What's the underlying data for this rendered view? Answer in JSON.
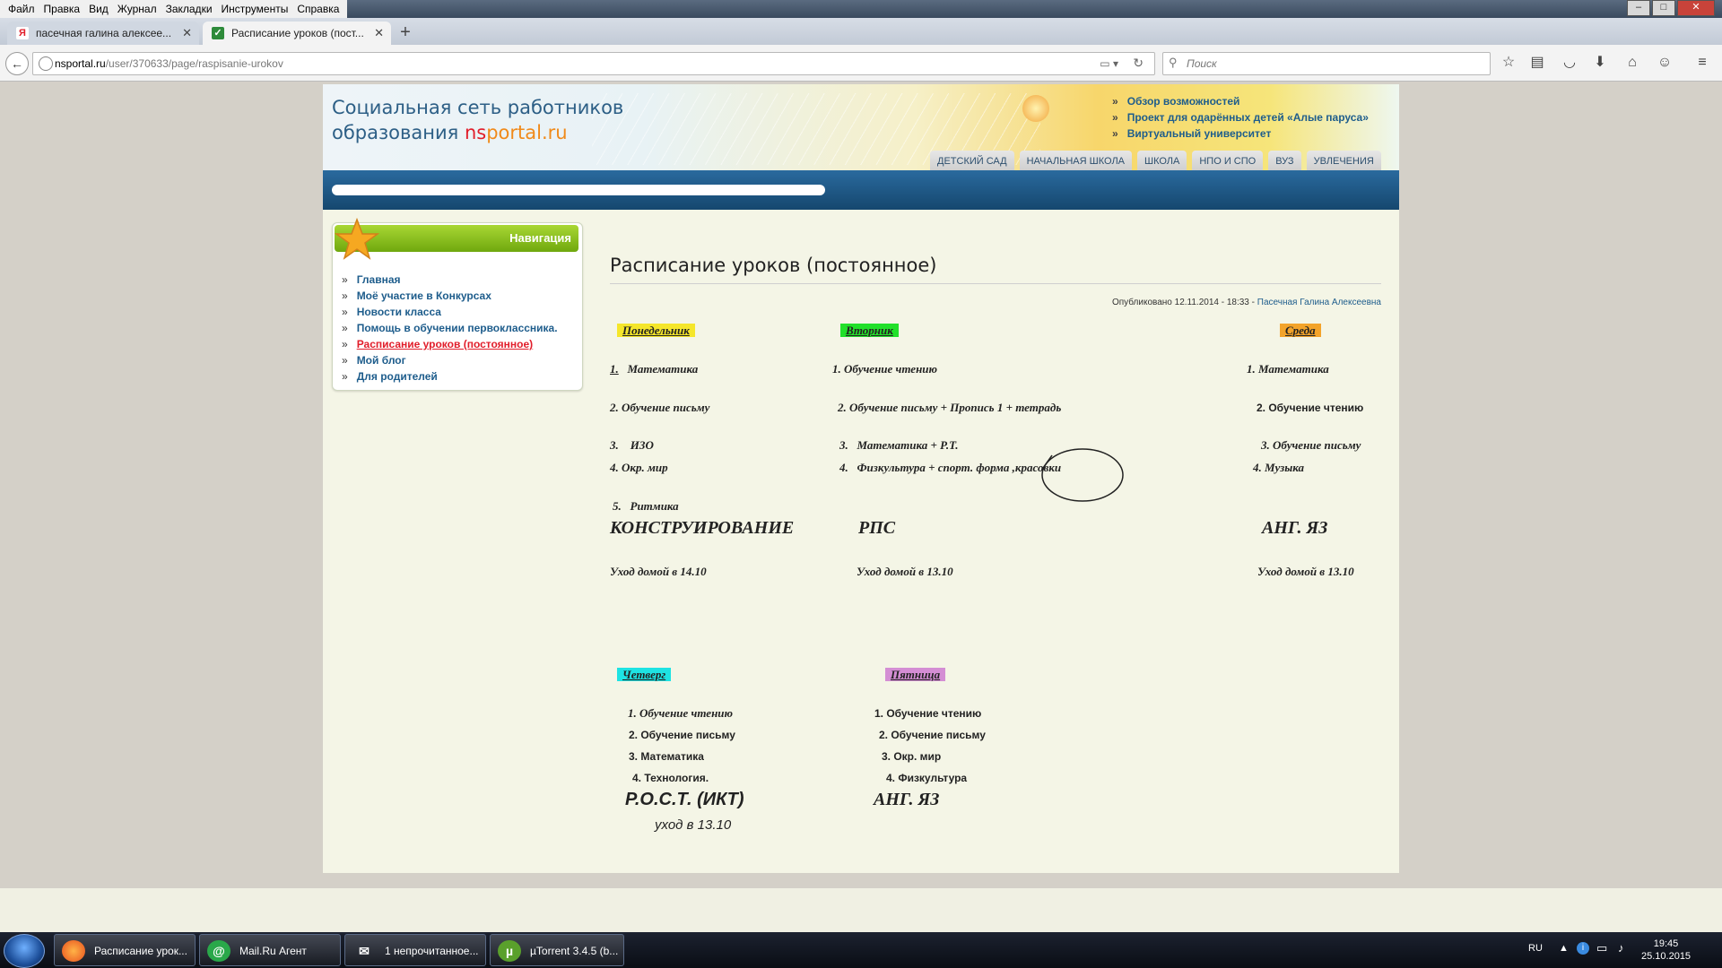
{
  "browser": {
    "menu": [
      "Файл",
      "Правка",
      "Вид",
      "Журнал",
      "Закладки",
      "Инструменты",
      "Справка"
    ],
    "tabs": [
      {
        "label": "пасечная галина алексее...",
        "favicon": "Я",
        "active": false
      },
      {
        "label": "Расписание уроков (пост...",
        "favicon": "✓",
        "active": true
      }
    ],
    "url_host": "nsportal.ru",
    "url_path": "/user/370633/page/raspisanie-urokov",
    "search_placeholder": "Поиск"
  },
  "site": {
    "title_line1": "Социальная сеть работников",
    "title_line2": "образования ",
    "brand_ns": "ns",
    "brand_portal": "portal.ru",
    "top_links": [
      "Обзор возможностей",
      "Проект для одарённых детей «Алые паруса»",
      "Виртуальный университет"
    ],
    "categories": [
      "ДЕТСКИЙ САД",
      "НАЧАЛЬНАЯ ШКОЛА",
      "ШКОЛА",
      "НПО И СПО",
      "ВУЗ",
      "УВЛЕЧЕНИЯ"
    ]
  },
  "nav": {
    "heading": "Навигация",
    "items": [
      "Главная",
      "Моё участие в Конкурсах",
      "Новости класса",
      "Помощь в обучении первоклассника.",
      "Расписание уроков (постоянное)",
      "Мой блог",
      "Для родителей"
    ],
    "active_index": 4
  },
  "article": {
    "title": "Расписание уроков (постоянное)",
    "published": "Опубликовано 12.11.2014 - 18:33 - ",
    "author": "Пасечная Галина Алексеевна"
  },
  "schedule": {
    "mon": {
      "day": "Понедельник",
      "l1n": "1.",
      "l1": "Математика",
      "l2": "2. Обучение письму",
      "l3n": "3.",
      "l3": "ИЗО",
      "l4": "4. Окр. мир",
      "l5n": "5.",
      "l5": "Ритмика",
      "extra": "КОНСТРУИРОВАНИЕ",
      "leave": "Уход домой в 14.10"
    },
    "tue": {
      "day": "Вторник",
      "l1": "1. Обучение чтению",
      "l2": "2. Обучение письму   + Пропись 1 + тетрадь",
      "l3n": "3.",
      "l3": "Математика   + Р.Т.",
      "l4n": "4.",
      "l4": "Физкультура + спорт. форма ,красовки",
      "extra": "РПС",
      "leave": "Уход домой в   13.10"
    },
    "wed": {
      "day": "Среда",
      "l1": "1. Математика",
      "l2": "2. Обучение чтению",
      "l3": "3. Обучение письму",
      "l4": "4. Музыка",
      "extra": "АНГ. ЯЗ",
      "leave": "Уход домой в 13.10"
    },
    "thu": {
      "day": "Четверг",
      "l1": "1. Обучение чтению",
      "l2": "2. Обучение письму",
      "l3": "3. Математика",
      "l4": "4. Технология.",
      "extra": "Р.О.С.Т.    (ИКТ)",
      "leave": "уход в 13.10"
    },
    "fri": {
      "day": "Пятница",
      "l1": "1. Обучение чтению",
      "l2": "2. Обучение письму",
      "l3": "3. Окр. мир",
      "l4": "4. Физкультура",
      "extra": "АНГ. ЯЗ"
    }
  },
  "taskbar": {
    "tasks": [
      {
        "label": "Расписание урок...",
        "icon": "firefox-icon"
      },
      {
        "label": "Mail.Ru Агент",
        "icon": "mail-agent-icon"
      },
      {
        "label": "1 непрочитанное...",
        "icon": "envelope-icon"
      },
      {
        "label": "µTorrent 3.4.5  (b...",
        "icon": "utorrent-icon"
      }
    ],
    "lang": "RU",
    "time": "19:45",
    "date": "25.10.2015"
  }
}
